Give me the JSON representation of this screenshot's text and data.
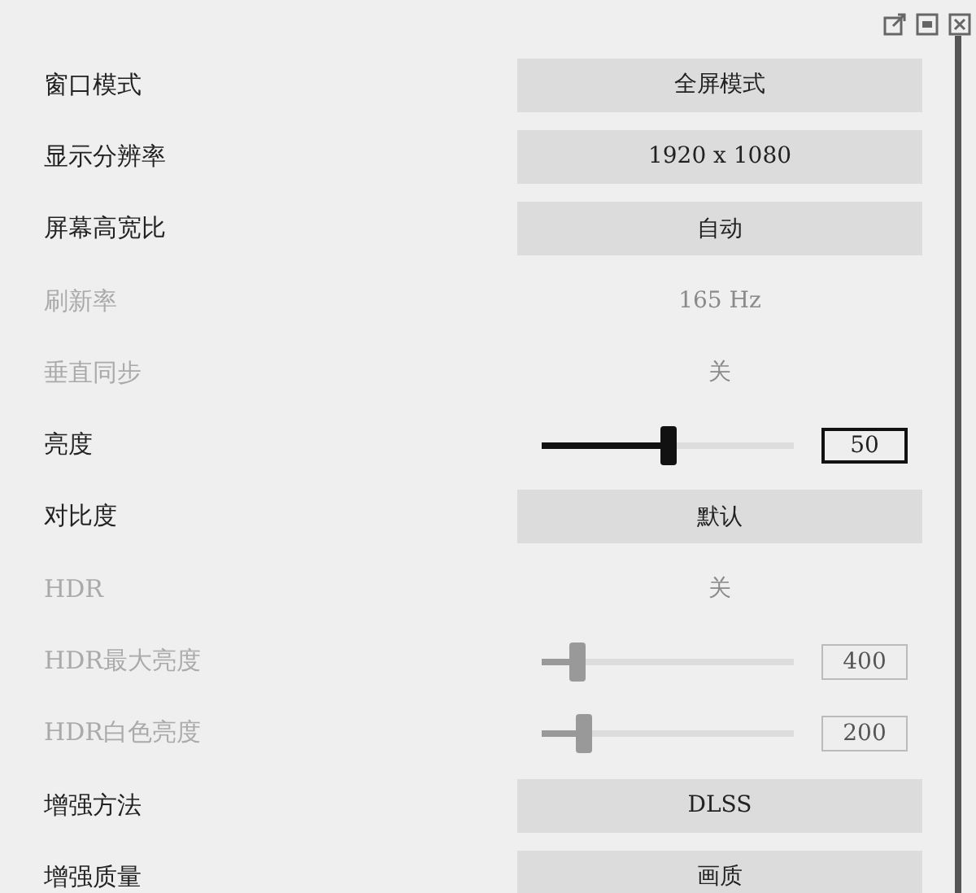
{
  "rows": [
    {
      "label": "窗口模式",
      "kind": "select",
      "value": "全屏模式",
      "disabled": false
    },
    {
      "label": "显示分辨率",
      "kind": "select",
      "value": "1920 x 1080",
      "disabled": false
    },
    {
      "label": "屏幕高宽比",
      "kind": "select",
      "value": "自动",
      "disabled": false
    },
    {
      "label": "刷新率",
      "kind": "select",
      "value": "165 Hz",
      "disabled": true
    },
    {
      "label": "垂直同步",
      "kind": "select",
      "value": "关",
      "disabled": true
    },
    {
      "label": "亮度",
      "kind": "slider",
      "level": 0.5,
      "value": "50",
      "disabled": false
    },
    {
      "label": "对比度",
      "kind": "select",
      "value": "默认",
      "disabled": false
    },
    {
      "label": "HDR",
      "kind": "select",
      "value": "关",
      "disabled": true
    },
    {
      "label": "HDR最大亮度",
      "kind": "slider",
      "level": 0.14,
      "value": "400",
      "disabled": true
    },
    {
      "label": "HDR白色亮度",
      "kind": "slider",
      "level": 0.17,
      "value": "200",
      "disabled": true
    },
    {
      "label": "增强方法",
      "kind": "select",
      "value": "DLSS",
      "disabled": false
    },
    {
      "label": "增强质量",
      "kind": "select",
      "value": "画质",
      "disabled": false
    }
  ]
}
